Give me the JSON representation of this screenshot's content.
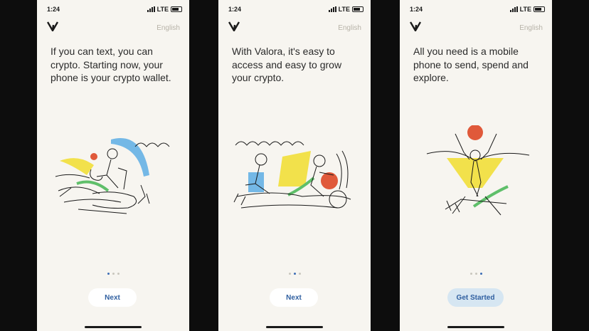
{
  "status": {
    "time": "1:24",
    "network": "LTE"
  },
  "screens": [
    {
      "language": "English",
      "headline": "If you can text, you can crypto. Starting now, your phone is your crypto wallet.",
      "button": "Next"
    },
    {
      "language": "English",
      "headline": "With Valora, it's easy to access and easy to grow your crypto.",
      "button": "Next"
    },
    {
      "language": "English",
      "headline": "All you need is a mobile phone to send, spend and explore.",
      "button": "Get Started"
    }
  ],
  "colors": {
    "accent": "#3d6db6",
    "button_text": "#2f5fa0",
    "primary_button_bg": "#d6e6f2",
    "illustration_yellow": "#f2e14b",
    "illustration_orange": "#e0593a",
    "illustration_blue": "#74b8e6",
    "illustration_green": "#5fbf6a"
  }
}
